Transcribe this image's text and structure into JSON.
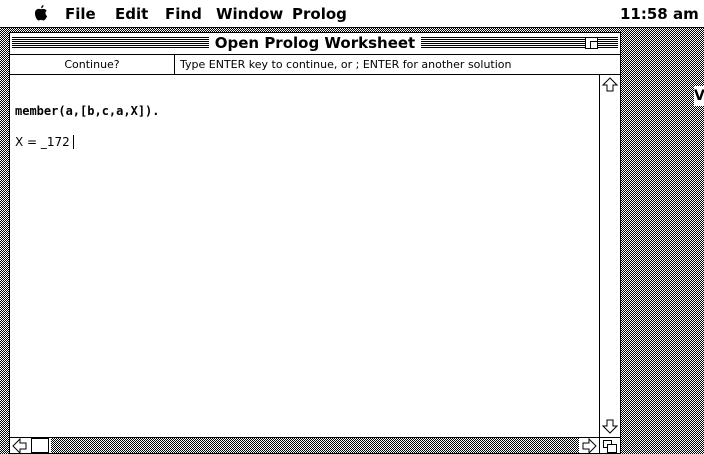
{
  "menubar": {
    "items": [
      "File",
      "Edit",
      "Find",
      "Window",
      "Prolog"
    ],
    "clock": "11:58 am"
  },
  "window": {
    "title": "Open Prolog Worksheet",
    "prompt_label": "Continue?",
    "prompt_message": "Type ENTER key to continue, or ; ENTER for another solution"
  },
  "worksheet": {
    "query": "member(a,[b,c,a,X]).",
    "result": "X = _172"
  },
  "desktop": {
    "peek_text": "V"
  },
  "icons": [
    "apple-icon",
    "zoom-box-icon",
    "up-arrow-icon",
    "down-arrow-icon",
    "left-arrow-icon",
    "right-arrow-icon",
    "grow-box-icon"
  ]
}
